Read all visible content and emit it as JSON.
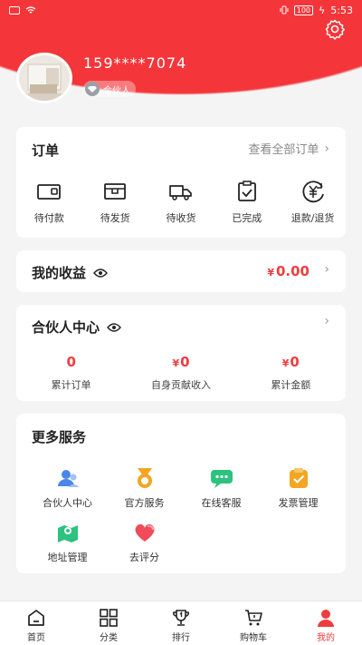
{
  "status": {
    "time": "5:53",
    "battery": "100"
  },
  "profile": {
    "phone": "159****7074",
    "role_badge": "合伙人"
  },
  "order": {
    "title": "订单",
    "view_all": "查看全部订单",
    "items": [
      {
        "label": "待付款",
        "icon": "wallet-icon"
      },
      {
        "label": "待发货",
        "icon": "package-box-icon"
      },
      {
        "label": "待收货",
        "icon": "delivery-truck-icon"
      },
      {
        "label": "已完成",
        "icon": "clipboard-check-icon"
      },
      {
        "label": "退款/退货",
        "icon": "yen-refund-icon"
      }
    ]
  },
  "income": {
    "title": "我的收益",
    "currency": "¥",
    "amount": "0.00"
  },
  "partner": {
    "title": "合伙人中心",
    "stats": [
      {
        "value": "0",
        "label": "累计订单",
        "currency": ""
      },
      {
        "value": "0",
        "label": "自身贡献收入",
        "currency": "¥"
      },
      {
        "value": "0",
        "label": "累计金额",
        "currency": "¥"
      }
    ]
  },
  "services": {
    "title": "更多服务",
    "items": [
      {
        "label": "合伙人中心",
        "icon": "partner-people-icon"
      },
      {
        "label": "官方服务",
        "icon": "medal-icon"
      },
      {
        "label": "在线客服",
        "icon": "chat-bubble-icon"
      },
      {
        "label": "发票管理",
        "icon": "invoice-icon"
      },
      {
        "label": "地址管理",
        "icon": "map-pin-icon"
      },
      {
        "label": "去评分",
        "icon": "heart-rating-icon"
      }
    ]
  },
  "tabs": [
    {
      "label": "首页",
      "icon": "home-icon"
    },
    {
      "label": "分类",
      "icon": "grid-icon"
    },
    {
      "label": "排行",
      "icon": "trophy-icon"
    },
    {
      "label": "购物车",
      "icon": "cart-icon"
    },
    {
      "label": "我的",
      "icon": "user-icon",
      "active": true
    }
  ],
  "colors": {
    "brand_red": "#ef3d3f",
    "header_red": "#f4363a"
  }
}
